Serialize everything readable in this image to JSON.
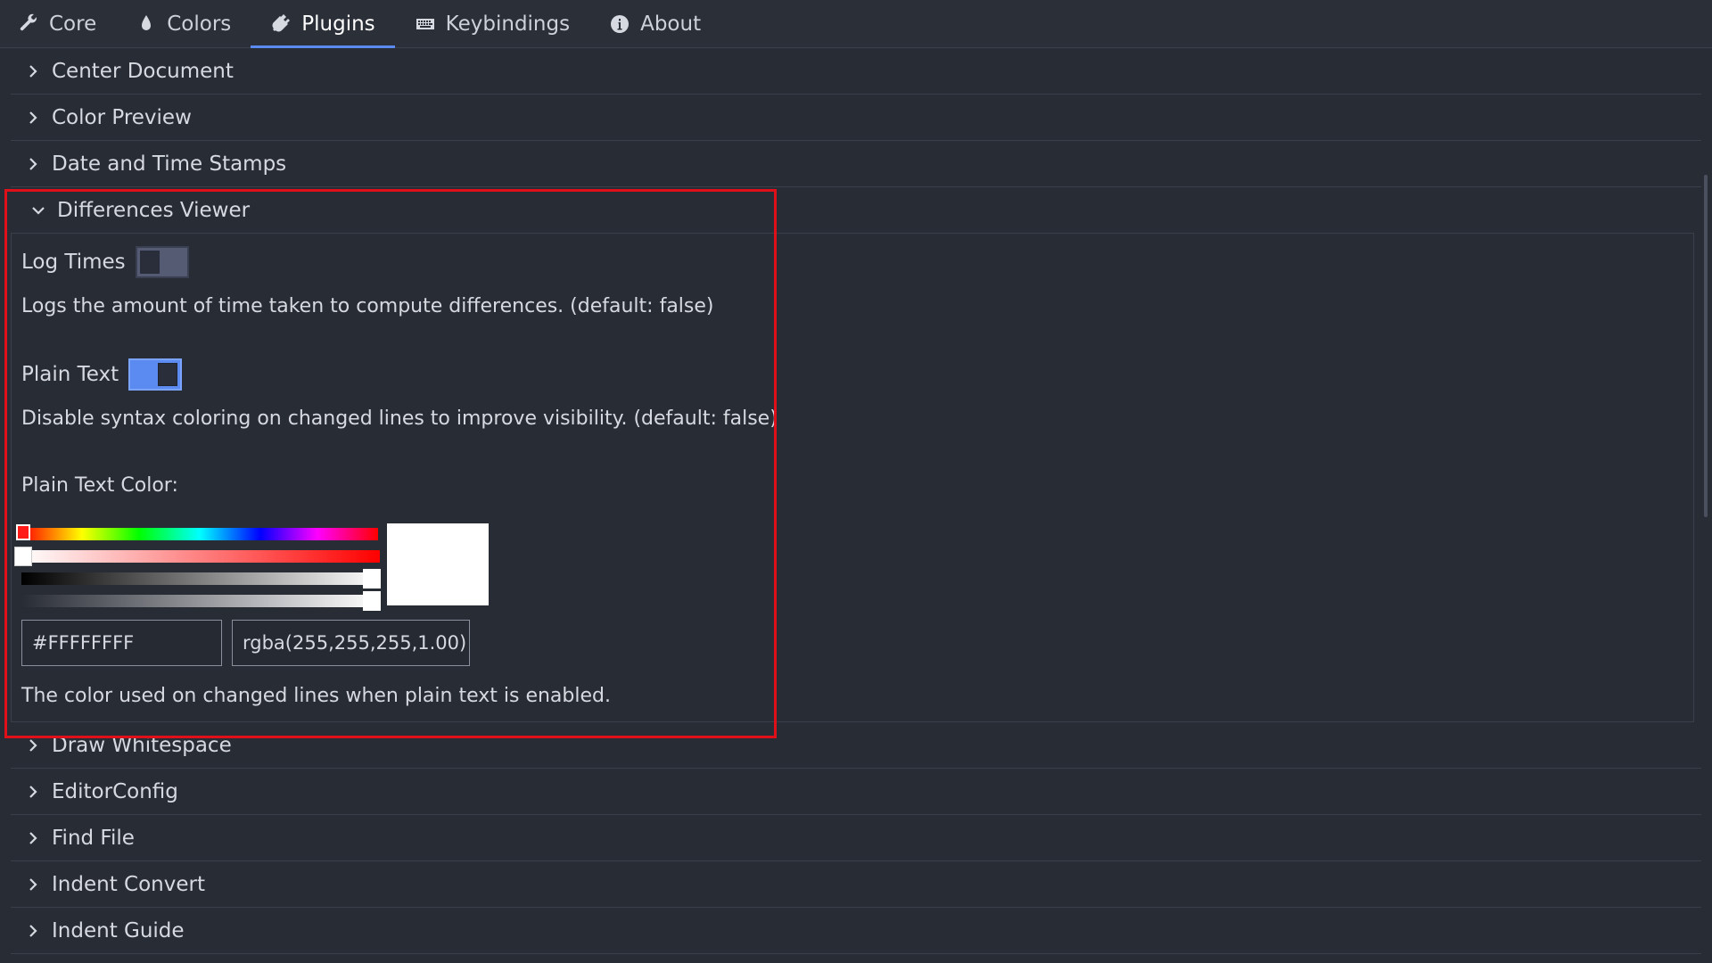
{
  "tabs": [
    {
      "label": "Core",
      "icon": "wrench-icon",
      "active": false
    },
    {
      "label": "Colors",
      "icon": "droplet-icon",
      "active": false
    },
    {
      "label": "Plugins",
      "icon": "plug-icon",
      "active": true
    },
    {
      "label": "Keybindings",
      "icon": "keyboard-icon",
      "active": false
    },
    {
      "label": "About",
      "icon": "info-icon",
      "active": false
    }
  ],
  "sections_before": [
    {
      "label": "Center Document"
    },
    {
      "label": "Color Preview"
    },
    {
      "label": "Date and Time Stamps"
    }
  ],
  "expanded_section": {
    "label": "Differences Viewer",
    "log_times": {
      "label": "Log Times",
      "value": false,
      "description": "Logs the amount of time taken to compute differences. (default: false)"
    },
    "plain_text": {
      "label": "Plain Text",
      "value": true,
      "description": "Disable syntax coloring on changed lines to improve visibility. (default: false)"
    },
    "plain_text_color": {
      "label": "Plain Text Color:",
      "hex": "#FFFFFFFF",
      "rgba": "rgba(255,255,255,1.00)",
      "swatch_color": "#FFFFFF",
      "description": "The color used on changed lines when plain text is enabled."
    }
  },
  "sections_after": [
    {
      "label": "Draw Whitespace"
    },
    {
      "label": "EditorConfig"
    },
    {
      "label": "Find File"
    },
    {
      "label": "Indent Convert"
    },
    {
      "label": "Indent Guide"
    }
  ],
  "colors": {
    "accent": "#5B8BF0",
    "highlight_border": "#E0101A",
    "background": "#282C35"
  }
}
